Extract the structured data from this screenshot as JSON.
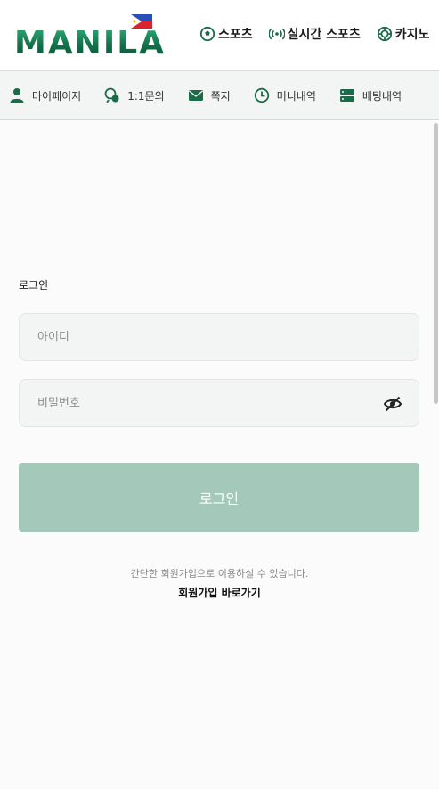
{
  "brand": {
    "logo_text": "MANILA",
    "accent": "#1a6b48",
    "button_disabled": "#a4c8b9"
  },
  "topnav": [
    {
      "label": "스포츠",
      "icon": "soccer-ball-icon"
    },
    {
      "label": "실시간 스포츠",
      "icon": "live-broadcast-icon"
    },
    {
      "label": "카지노",
      "icon": "casino-chip-icon"
    }
  ],
  "subnav": [
    {
      "label": "마이페이지",
      "icon": "user-icon"
    },
    {
      "label": "1:1문의",
      "icon": "chat-support-icon"
    },
    {
      "label": "쪽지",
      "icon": "envelope-icon"
    },
    {
      "label": "머니내역",
      "icon": "clock-icon"
    },
    {
      "label": "베팅내역",
      "icon": "list-icon"
    }
  ],
  "login": {
    "title": "로그인",
    "id_placeholder": "아이디",
    "pw_placeholder": "비밀번호",
    "button_label": "로그인"
  },
  "signup": {
    "description": "간단한 회원가입으로 이용하실 수 있습니다.",
    "link_label": "회원가입 바로가기"
  }
}
